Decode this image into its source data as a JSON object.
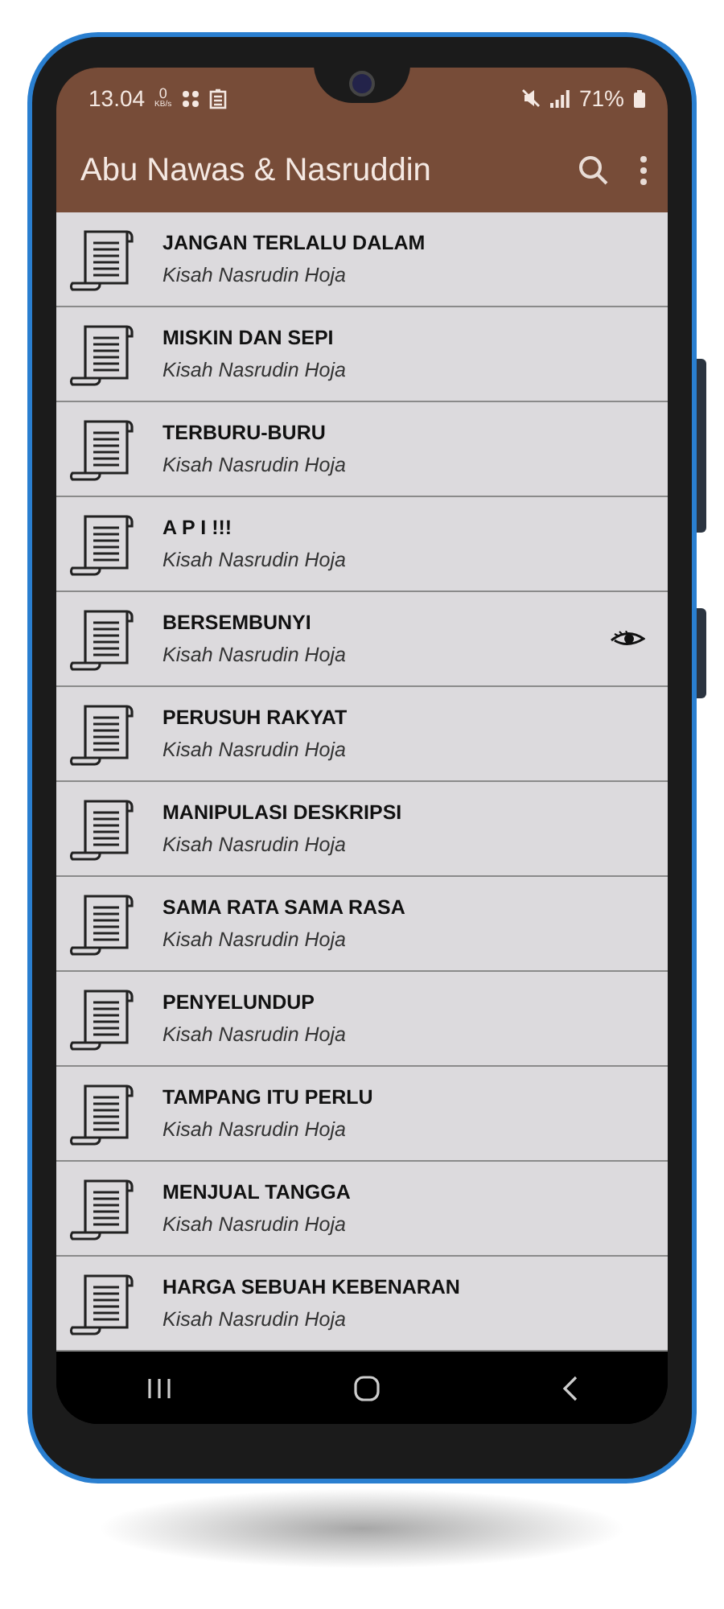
{
  "status_bar": {
    "time": "13.04",
    "net_speed": "0",
    "net_unit": "KB/s",
    "battery": "71%"
  },
  "app_bar": {
    "title": "Abu Nawas & Nasruddin"
  },
  "stories": [
    {
      "title": "JANGAN TERLALU DALAM",
      "subtitle": "Kisah Nasrudin Hoja",
      "seen": false
    },
    {
      "title": "MISKIN DAN SEPI",
      "subtitle": "Kisah Nasrudin Hoja",
      "seen": false
    },
    {
      "title": "TERBURU-BURU",
      "subtitle": "Kisah Nasrudin Hoja",
      "seen": false
    },
    {
      "title": "A P I !!!",
      "subtitle": "Kisah Nasrudin Hoja",
      "seen": false
    },
    {
      "title": "BERSEMBUNYI",
      "subtitle": "Kisah Nasrudin Hoja",
      "seen": true
    },
    {
      "title": "PERUSUH RAKYAT",
      "subtitle": "Kisah Nasrudin Hoja",
      "seen": false
    },
    {
      "title": "MANIPULASI DESKRIPSI",
      "subtitle": "Kisah Nasrudin Hoja",
      "seen": false
    },
    {
      "title": "SAMA RATA SAMA RASA",
      "subtitle": "Kisah Nasrudin Hoja",
      "seen": false
    },
    {
      "title": "PENYELUNDUP",
      "subtitle": "Kisah Nasrudin Hoja",
      "seen": false
    },
    {
      "title": "TAMPANG ITU PERLU",
      "subtitle": "Kisah Nasrudin Hoja",
      "seen": false
    },
    {
      "title": "MENJUAL TANGGA",
      "subtitle": "Kisah Nasrudin Hoja",
      "seen": false
    },
    {
      "title": "HARGA SEBUAH KEBENARAN",
      "subtitle": "Kisah Nasrudin Hoja",
      "seen": false
    }
  ]
}
